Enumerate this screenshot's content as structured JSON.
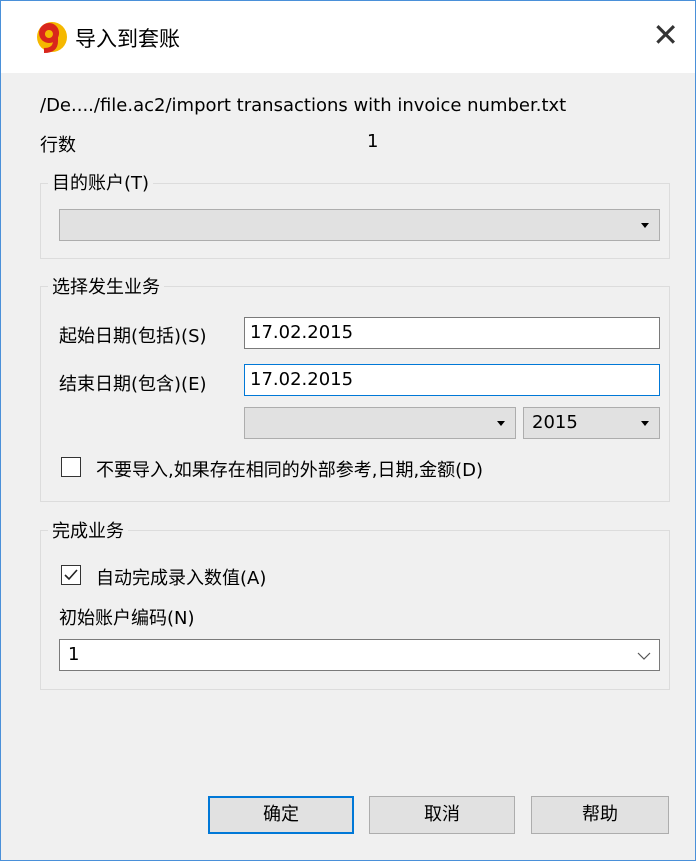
{
  "window": {
    "title": "导入到套账",
    "close_glyph": "✕"
  },
  "file_path": "/De..../file.ac2/import transactions with invoice number.txt",
  "rows": {
    "label": "行数",
    "value": "1"
  },
  "target_account": {
    "legend": "目的账户(T)",
    "selected": ""
  },
  "select_transactions": {
    "legend": "选择发生业务",
    "start_label": "起始日期(包括)(S)",
    "start_value": "17.02.2015",
    "end_label": "结束日期(包含)(E)",
    "end_value": "17.02.2015",
    "period_selected": "",
    "year_selected": "2015",
    "no_duplicates_label": "不要导入,如果存在相同的外部参考,日期,金额(D)",
    "no_duplicates_checked": false
  },
  "complete_transactions": {
    "legend": "完成业务",
    "autocomplete_label": "自动完成录入数值(A)",
    "autocomplete_checked": true,
    "initial_code_label": "初始账户编码(N)",
    "initial_code_value": "1"
  },
  "buttons": {
    "ok": "确定",
    "cancel": "取消",
    "help": "帮助"
  },
  "colors": {
    "accent": "#0078d7",
    "logo_red": "#d9261c",
    "logo_yellow": "#f5b800"
  }
}
